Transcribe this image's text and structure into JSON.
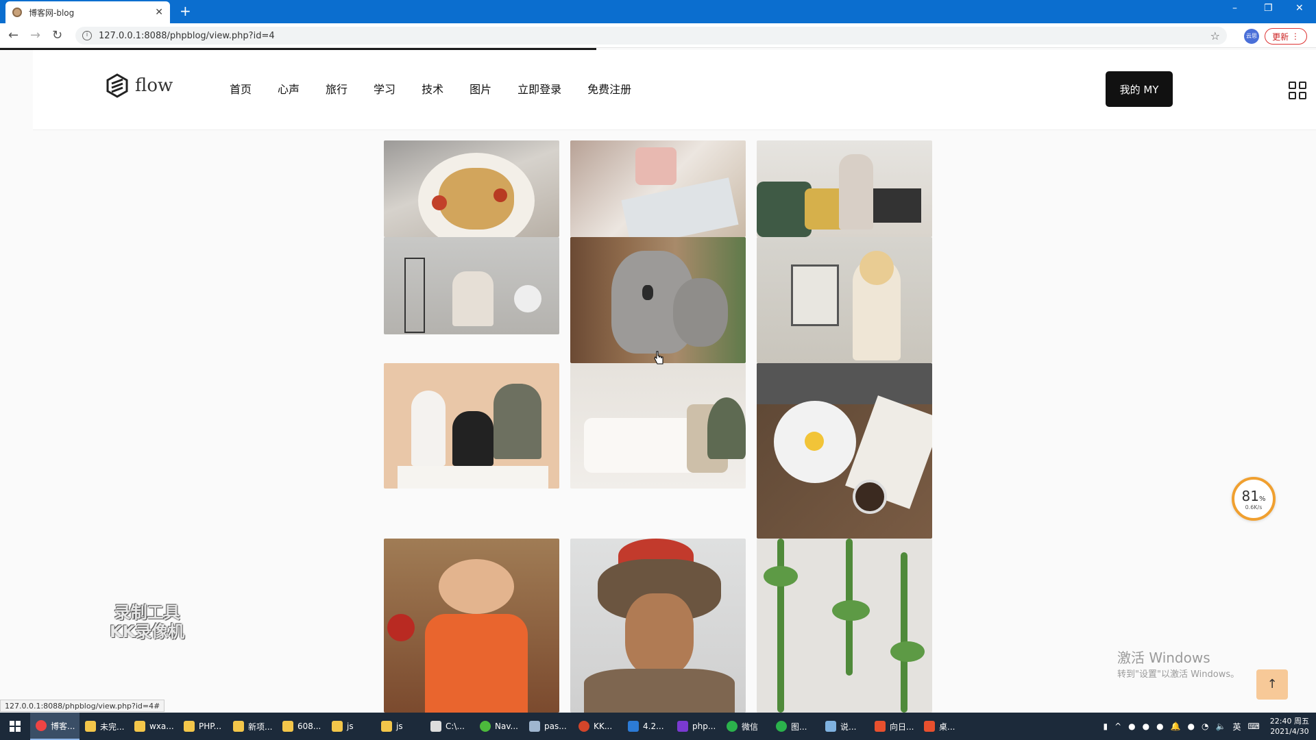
{
  "browser": {
    "tab_title": "博客网-blog",
    "url": "127.0.0.1:8088/phpblog/view.php?id=4",
    "update_label": "更新",
    "profile_label": "云思",
    "status_url": "127.0.0.1:8088/phpblog/view.php?id=4#"
  },
  "site": {
    "logo_text": "flow",
    "nav": [
      "首页",
      "心声",
      "旅行",
      "学习",
      "技术",
      "图片",
      "立即登录",
      "免费注册"
    ],
    "my_button": "我的 MY"
  },
  "gallery": [
    {
      "subject": "spaghetti-with-tomatoes"
    },
    {
      "subject": "coffee-cup-and-magazine"
    },
    {
      "subject": "woman-with-laptop-on-sofa"
    },
    {
      "subject": "man-reading-in-chair"
    },
    {
      "subject": "koalas-on-tree"
    },
    {
      "subject": "woman-painting-on-easel"
    },
    {
      "subject": "team-around-laptop"
    },
    {
      "subject": "cozy-white-living-room"
    },
    {
      "subject": "breakfast-egg-and-book"
    },
    {
      "subject": "woman-in-orange-dress"
    },
    {
      "subject": "man-in-fur-hat"
    },
    {
      "subject": "ivy-on-white-wall"
    }
  ],
  "overlays": {
    "watermark_line1": "录制工具",
    "watermark_line2": "KK录像机",
    "activate_title": "激活 Windows",
    "activate_sub": "转到\"设置\"以激活 Windows。",
    "gauge_value": "81",
    "gauge_unit": "%",
    "gauge_rate": "0.6K/s",
    "totop": "↑"
  },
  "taskbar": {
    "apps": [
      "博客...",
      "未完...",
      "wxa...",
      "PHP...",
      "新项...",
      "608...",
      "js",
      "js",
      "C:\\...",
      "Nav...",
      "pas...",
      "KK...",
      "4.2...",
      "php...",
      "微信",
      "图...",
      "说...",
      "向日...",
      "桌..."
    ],
    "ime": "英",
    "time": "22:40 周五",
    "date": "2021/4/30"
  }
}
